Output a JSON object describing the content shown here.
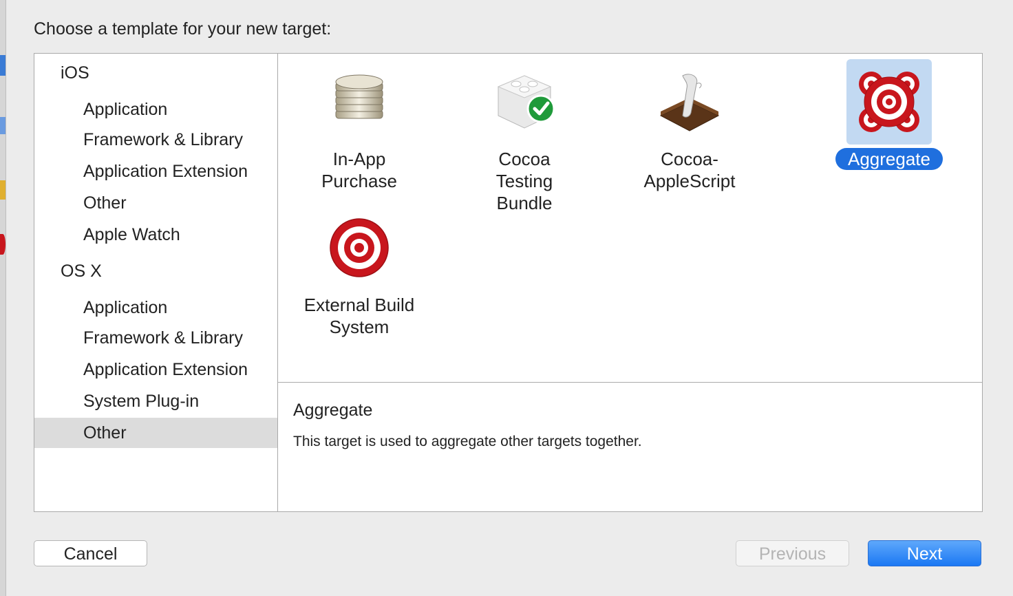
{
  "dialog": {
    "heading": "Choose a template for your new target:"
  },
  "sidebar": {
    "groups": [
      {
        "label": "iOS"
      },
      {
        "label": "OS X"
      }
    ],
    "ios_items": [
      "Application",
      "Framework & Library",
      "Application Extension",
      "Other",
      "Apple Watch"
    ],
    "osx_items": [
      "Application",
      "Framework & Library",
      "Application Extension",
      "System Plug-in",
      "Other"
    ],
    "selected": "OS X / Other"
  },
  "templates": [
    {
      "label_line1": "In-App",
      "label_line2": "Purchase",
      "icon": "coin-stack-icon"
    },
    {
      "label_line1": "Cocoa Testing",
      "label_line2": "Bundle",
      "icon": "test-block-icon"
    },
    {
      "label_line1": "Cocoa-",
      "label_line2": "AppleScript",
      "icon": "script-scroll-icon"
    },
    {
      "label_line1": "Aggregate",
      "label_line2": "",
      "icon": "aggregate-targets-icon",
      "selected": true
    },
    {
      "label_line1": "External Build",
      "label_line2": "System",
      "icon": "target-icon"
    }
  ],
  "description": {
    "title": "Aggregate",
    "text": "This target is used to aggregate other targets together."
  },
  "buttons": {
    "cancel": "Cancel",
    "previous": "Previous",
    "next": "Next"
  },
  "colors": {
    "selection_blue": "#1f6fde",
    "icon_selection_bg": "#c2d9f2",
    "target_red": "#c8161d"
  }
}
